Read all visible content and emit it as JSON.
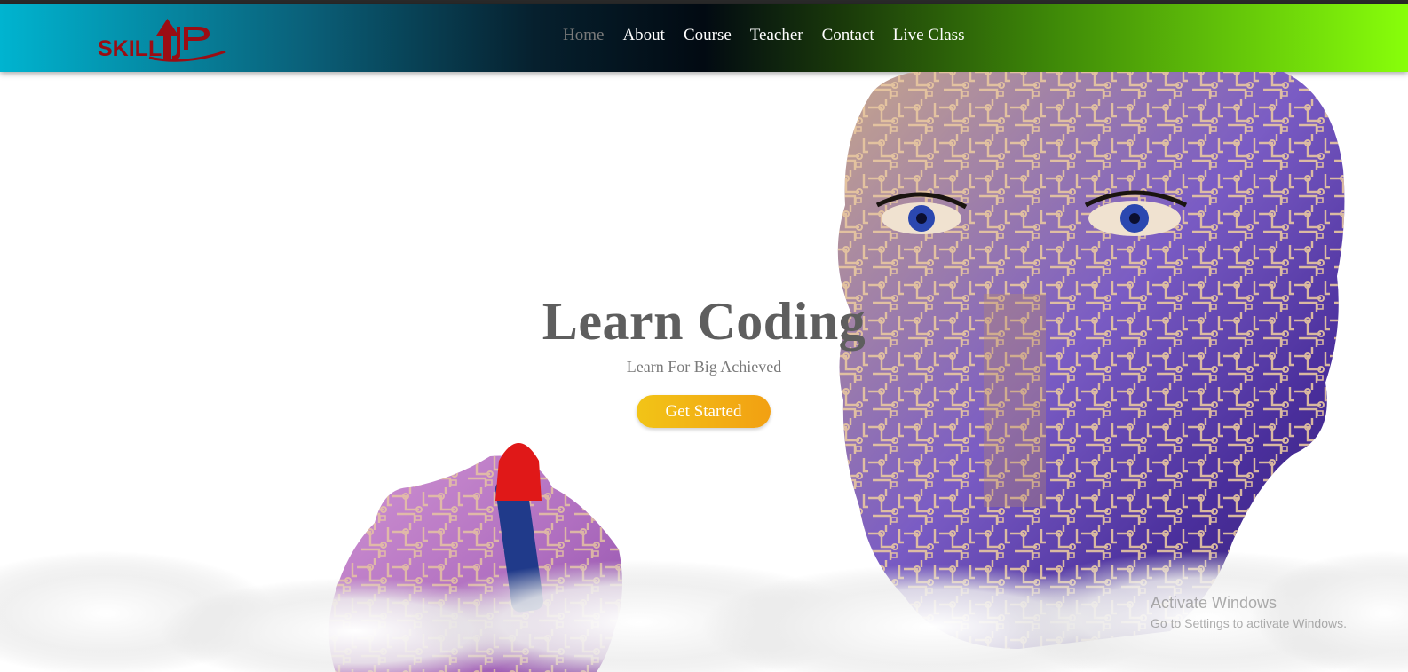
{
  "brand": {
    "logo_text": "SKILLUP"
  },
  "nav": {
    "items": [
      {
        "label": "Home",
        "active": true
      },
      {
        "label": "About",
        "active": false
      },
      {
        "label": "Course",
        "active": false
      },
      {
        "label": "Teacher",
        "active": false
      },
      {
        "label": "Contact",
        "active": false
      },
      {
        "label": "Live Class",
        "active": false
      }
    ]
  },
  "hero": {
    "title": "Learn Coding",
    "subtitle": "Learn For Big Achieved",
    "cta_label": "Get Started"
  },
  "watermark": {
    "title": "Activate Windows",
    "subtitle": "Go to Settings to activate Windows."
  },
  "colors": {
    "logo": "#9b0d13",
    "cta_start": "#f2c417",
    "cta_end": "#f2a012",
    "title": "#5e5e5e"
  }
}
